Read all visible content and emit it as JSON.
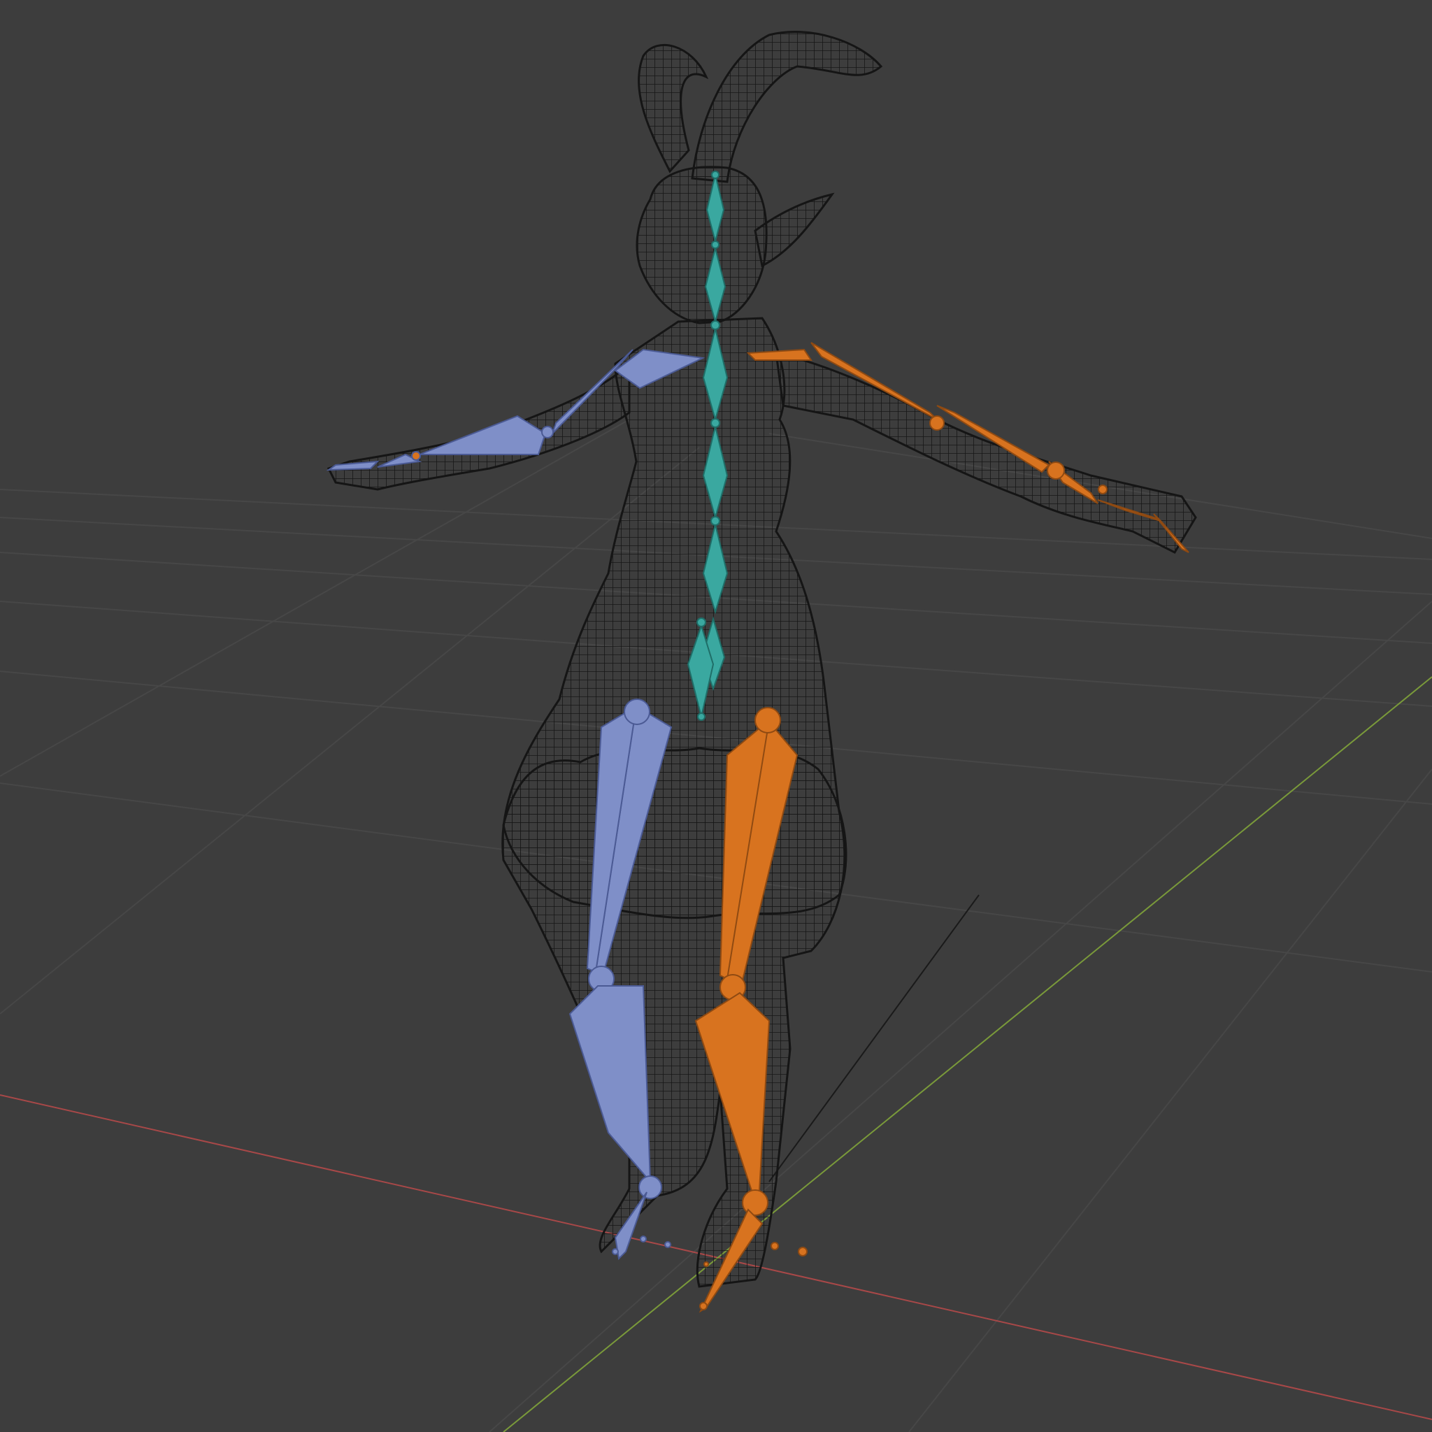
{
  "viewport": {
    "background": "#3d3d3d",
    "grid_color": "#4a4a4a",
    "x_axis_color": "#b04a4a",
    "y_axis_color": "#7a9a3a",
    "wire_color": "#141414"
  },
  "bone_colors": {
    "spine": "#3aa8a0",
    "left_side": "#7f8fc8",
    "right_side": "#d8731f"
  },
  "icons": {
    "mesh": "wireframe-mesh-icon",
    "armature": "armature-bones-icon"
  }
}
